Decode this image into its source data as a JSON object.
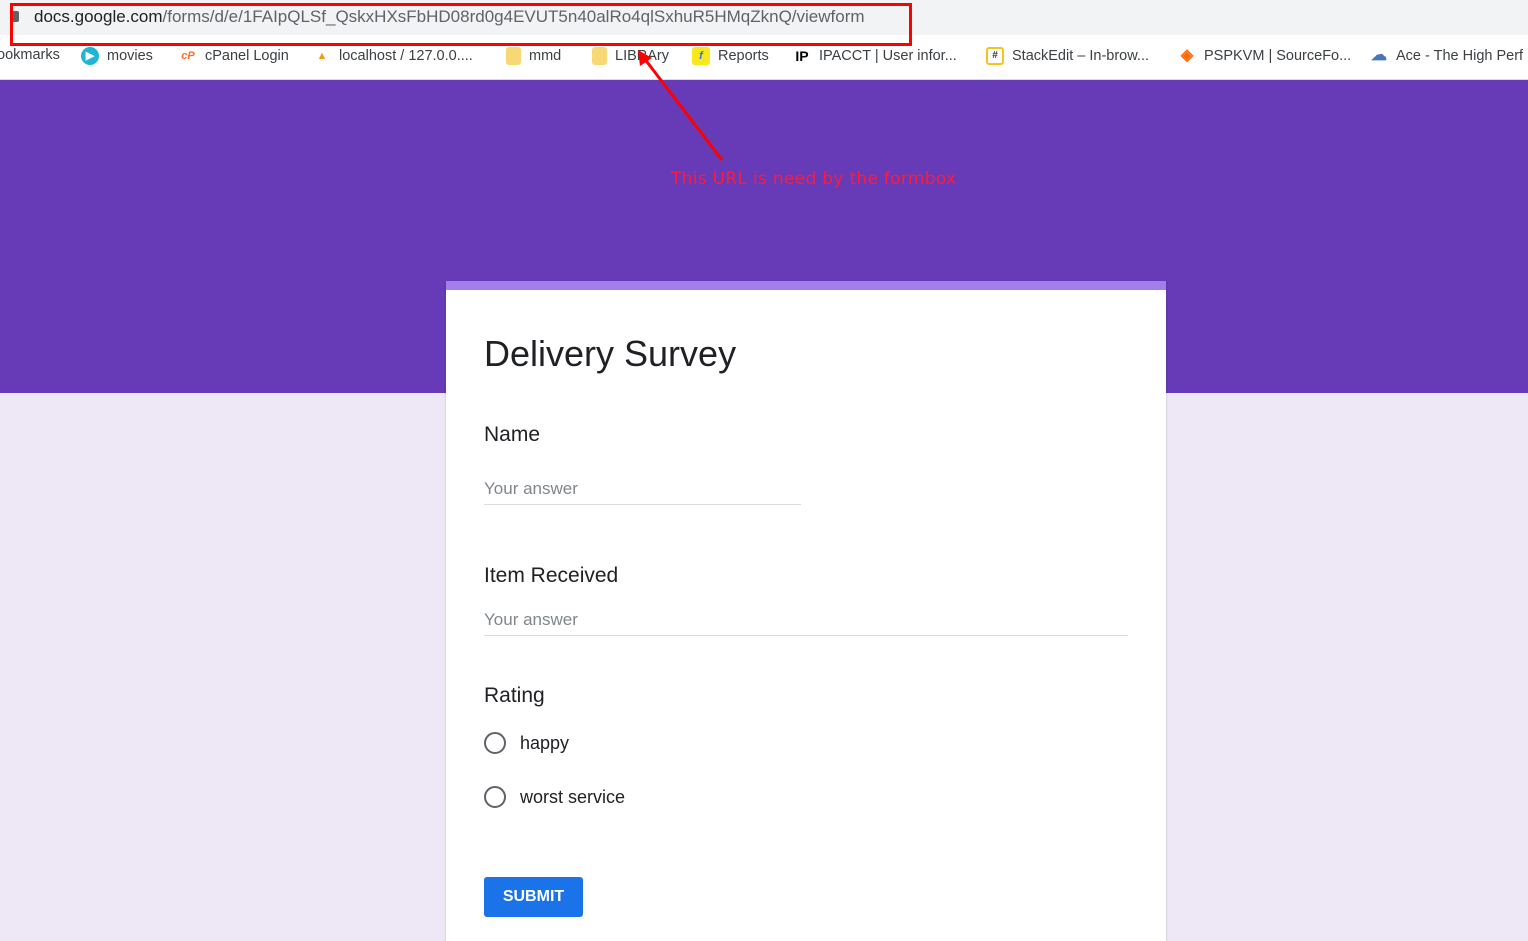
{
  "browser": {
    "url_host": "docs.google.com",
    "url_path": "/forms/d/e/1FAIpQLSf_QskxHXsFbHD08rd0g4EVUT5n40alRo4qlSxhuR5HMqZknQ/viewform",
    "bookmarks": [
      {
        "label": "ookmarks",
        "icon": "bookmarks-icon"
      },
      {
        "label": "movies",
        "icon": "play-icon",
        "color": "#1fb5d6"
      },
      {
        "label": "cPanel Login",
        "icon": "cpanel-icon",
        "color": "#ff6c2c"
      },
      {
        "label": "localhost / 127.0.0....",
        "icon": "phpmyadmin-icon",
        "color": "#f89c0e"
      },
      {
        "label": "mmd",
        "icon": "folder-icon",
        "color": "#f8d775"
      },
      {
        "label": "LIBRAry",
        "icon": "folder-icon",
        "color": "#f8d775"
      },
      {
        "label": "Reports",
        "icon": "flipkart-icon",
        "color": "#f8e71c"
      },
      {
        "label": "IPACCT | User infor...",
        "icon": "ipacct-icon",
        "color": "#000000"
      },
      {
        "label": "StackEdit – In-brow...",
        "icon": "stackedit-icon",
        "color": "#f5c518"
      },
      {
        "label": "PSPKVM | SourceFo...",
        "icon": "sourceforge-icon",
        "color": "#ff6600"
      },
      {
        "label": "Ace - The High Perf",
        "icon": "ace-cloud-icon",
        "color": "#4a74b8"
      }
    ]
  },
  "annotation": {
    "text": "This URL is need by the formbox",
    "color": "#ff0000"
  },
  "form": {
    "title": "Delivery Survey",
    "accent": "#673ab7",
    "questions": [
      {
        "label": "Name",
        "placeholder": "Your answer"
      },
      {
        "label": "Item Received",
        "placeholder": "Your answer"
      },
      {
        "label": "Rating",
        "options": [
          "happy",
          "worst service"
        ]
      }
    ],
    "submit_label": "SUBMIT"
  }
}
